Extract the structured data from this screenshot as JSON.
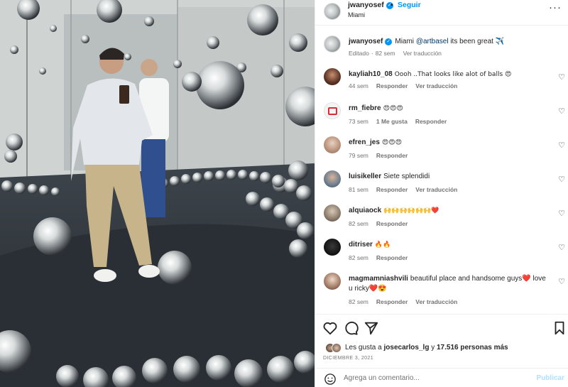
{
  "post": {
    "username": "jwanyosef",
    "follow_label": "Seguir",
    "location": "Miami",
    "more_label": "···"
  },
  "caption": {
    "username": "jwanyosef",
    "text_before": "Miami ",
    "mention": "@artbasel",
    "text_after": " its been great ✈️",
    "edited_label": "Editado",
    "time": "82 sem",
    "translate_label": "Ver traducción"
  },
  "comments": [
    {
      "username": "kayliah10_08",
      "text": "Oooh ..That looks like alot of balls 😍",
      "time": "44 sem",
      "reply": "Responder",
      "translate": "Ver traducción",
      "likes": ""
    },
    {
      "username": "rm_fiebre",
      "text": "😍😍😍",
      "time": "73 sem",
      "reply": "Responder",
      "translate": "",
      "likes": "1 Me gusta"
    },
    {
      "username": "efren_jes",
      "text": "😍😍😍",
      "time": "79 sem",
      "reply": "Responder",
      "translate": "",
      "likes": ""
    },
    {
      "username": "luisikeller",
      "text": "Siete splendidi",
      "time": "81 sem",
      "reply": "Responder",
      "translate": "Ver traducción",
      "likes": ""
    },
    {
      "username": "alquiaock",
      "text": "🙌🙌🙌🙌🙌🙌❤️",
      "time": "82 sem",
      "reply": "Responder",
      "translate": "",
      "likes": ""
    },
    {
      "username": "ditriser",
      "text": "🔥🔥",
      "time": "82 sem",
      "reply": "Responder",
      "translate": "",
      "likes": ""
    },
    {
      "username": "magmamniashvili",
      "text": "beautiful place and handsome guys❤️ love u ricky❤️😍",
      "time": "82 sem",
      "reply": "Responder",
      "translate": "Ver traducción",
      "likes": ""
    }
  ],
  "likes": {
    "prefix": "Les gusta a",
    "user": "josecarlos_lg",
    "middle": "y",
    "count": "17.516 personas más"
  },
  "date": "DICIEMBRE 3, 2021",
  "add_comment": {
    "placeholder": "Agrega un comentario...",
    "publish_label": "Publicar"
  },
  "icons": {
    "like": "heart-icon",
    "comment": "comment-icon",
    "share": "share-icon",
    "save": "bookmark-icon",
    "emoji": "emoji-icon",
    "verified": "verified-badge-icon"
  },
  "colors": {
    "link": "#0095f6",
    "mention": "#00376b",
    "muted": "#737373",
    "publish_disabled": "#b2dffc"
  }
}
